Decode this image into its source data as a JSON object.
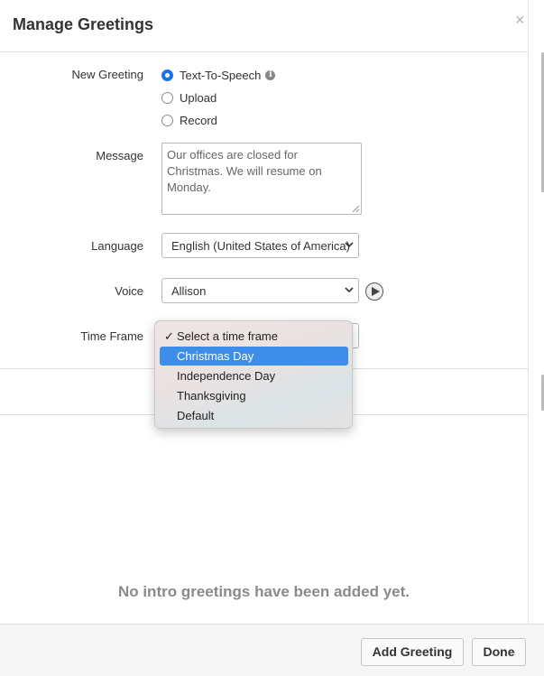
{
  "modal": {
    "title": "Manage Greetings",
    "close_glyph": "×"
  },
  "form": {
    "new_greeting": {
      "label": "New Greeting",
      "options": [
        {
          "label": "Text-To-Speech",
          "checked": true
        },
        {
          "label": "Upload",
          "checked": false
        },
        {
          "label": "Record",
          "checked": false
        }
      ],
      "info_icon": "info-icon"
    },
    "message": {
      "label": "Message",
      "value": "Our offices are closed for Christmas. We will resume on Monday."
    },
    "language": {
      "label": "Language",
      "value": "English (United States of America)"
    },
    "voice": {
      "label": "Voice",
      "value": "Allison",
      "play_icon": "play-icon"
    },
    "time_frame": {
      "label": "Time Frame",
      "options": [
        {
          "label": "Select a time frame",
          "checked": true,
          "highlighted": false
        },
        {
          "label": "Christmas Day",
          "checked": false,
          "highlighted": true
        },
        {
          "label": "Independence Day",
          "checked": false,
          "highlighted": false
        },
        {
          "label": "Thanksgiving",
          "checked": false,
          "highlighted": false
        },
        {
          "label": "Default",
          "checked": false,
          "highlighted": false
        }
      ]
    }
  },
  "intro_greetings": {
    "empty_message": "No intro greetings have been added yet."
  },
  "footer": {
    "add_label": "Add Greeting",
    "done_label": "Done"
  },
  "colors": {
    "accent": "#1a73e8",
    "highlight": "#3d8ee8"
  }
}
